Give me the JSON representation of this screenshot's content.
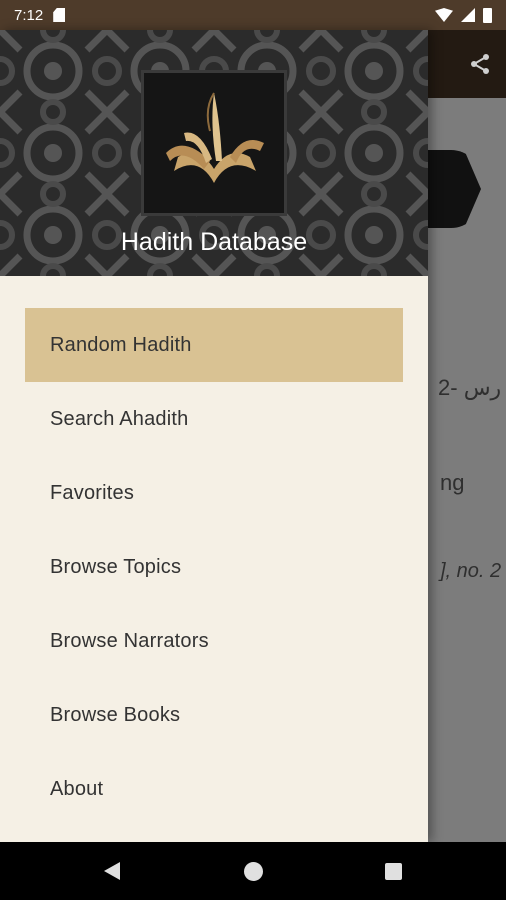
{
  "status_bar": {
    "time": "7:12",
    "icons": [
      "sd-card-icon",
      "wifi-icon",
      "signal-icon",
      "battery-icon"
    ]
  },
  "background_app": {
    "toolbar_icons": [
      "share-icon"
    ],
    "text_fragments": [
      "2- رس",
      "ng",
      "], no. 2"
    ]
  },
  "drawer": {
    "header": {
      "title": "Hadith Database",
      "logo": "quill-book-logo"
    },
    "menu_items": [
      {
        "label": "Random Hadith",
        "active": true
      },
      {
        "label": "Search Ahadith",
        "active": false
      },
      {
        "label": "Favorites",
        "active": false
      },
      {
        "label": "Browse Topics",
        "active": false
      },
      {
        "label": "Browse Narrators",
        "active": false
      },
      {
        "label": "Browse Books",
        "active": false
      },
      {
        "label": "About",
        "active": false
      }
    ]
  },
  "nav_bar": {
    "icons": [
      "back-icon",
      "home-icon",
      "recents-icon"
    ]
  },
  "colors": {
    "status_bar": "#4e3b2a",
    "drawer_bg": "#f5f0e5",
    "active_item": "#d9c293",
    "header_bg": "#2b2b2b",
    "logo_gold": "#c9a46a"
  }
}
